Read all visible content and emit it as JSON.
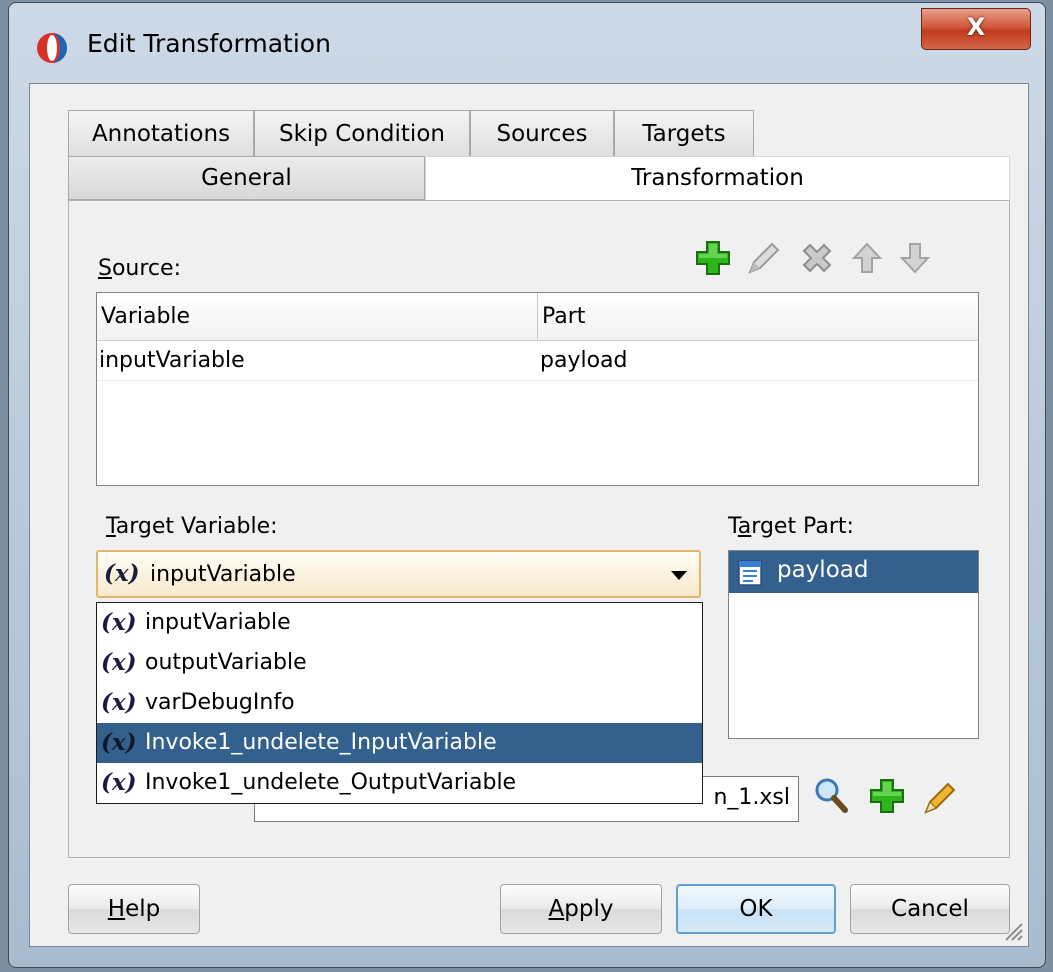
{
  "window": {
    "title": "Edit Transformation",
    "close_label": "X"
  },
  "tabs_row1": [
    {
      "label": "Annotations"
    },
    {
      "label": "Skip Condition"
    },
    {
      "label": "Sources"
    },
    {
      "label": "Targets"
    }
  ],
  "tabs_row2": [
    {
      "label": "General",
      "active": false
    },
    {
      "label": "Transformation",
      "active": true
    }
  ],
  "source": {
    "label_u": "S",
    "label_rest": "ource:",
    "columns": [
      "Variable",
      "Part"
    ],
    "rows": [
      {
        "variable": "inputVariable",
        "part": "payload"
      }
    ],
    "toolbar": [
      "add-icon",
      "edit-icon",
      "delete-icon",
      "move-up-icon",
      "move-down-icon"
    ]
  },
  "target_variable": {
    "label_u": "T",
    "label_rest": "arget Variable:",
    "selected": "inputVariable",
    "var_symbol": "(x)",
    "options": [
      {
        "label": "inputVariable",
        "highlighted": false
      },
      {
        "label": "outputVariable",
        "highlighted": false
      },
      {
        "label": "varDebugInfo",
        "highlighted": false
      },
      {
        "label": "Invoke1_undelete_InputVariable",
        "highlighted": true
      },
      {
        "label": "Invoke1_undelete_OutputVariable",
        "highlighted": false
      }
    ]
  },
  "target_part": {
    "label_pre": "T",
    "label_u": "a",
    "label_rest": "rget Part:",
    "items": [
      {
        "label": "payload",
        "selected": true
      }
    ]
  },
  "mapper_file": {
    "value_visible": "n_1.xsl"
  },
  "buttons": {
    "help_u": "H",
    "help_rest": "elp",
    "apply_u": "A",
    "apply_rest": "pply",
    "ok": "OK",
    "cancel": "Cancel"
  },
  "colors": {
    "selection": "#34608e",
    "accent_green": "#2fb51c",
    "close_red": "#c8452a"
  }
}
